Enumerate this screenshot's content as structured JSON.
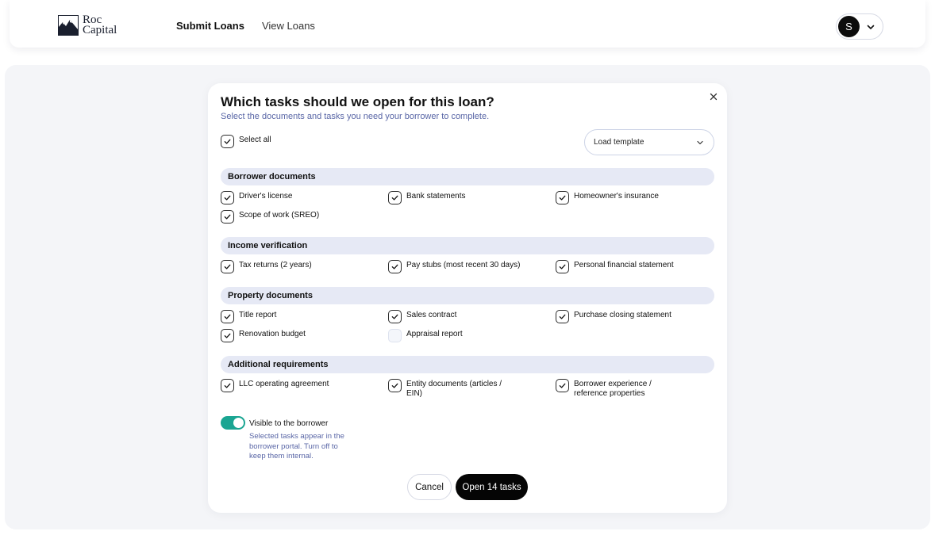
{
  "header": {
    "logo": {
      "line1": "Roc",
      "line2": "Capital"
    },
    "nav": [
      {
        "label": "Submit Loans",
        "active": true
      },
      {
        "label": "View Loans",
        "active": false
      }
    ],
    "user": {
      "initial": "S",
      "icon": "chevron-down-icon"
    }
  },
  "modal": {
    "title": "Which tasks should we open for this loan?",
    "subtitle": "Select the documents and tasks you need your borrower to complete.",
    "select_all": {
      "label": "Select all",
      "checked": true
    },
    "template_select": {
      "value": "Load template",
      "icon": "chevron-down-icon"
    },
    "close_icon": "close-icon",
    "sections": [
      {
        "title": "Borrower documents",
        "items": [
          {
            "label": "Driver's license",
            "checked": true
          },
          {
            "label": "Bank statements",
            "checked": true
          },
          {
            "label": "Homeowner's insurance",
            "checked": true
          },
          {
            "label": "Scope of work (SREO)",
            "checked": true
          }
        ]
      },
      {
        "title": "Income verification",
        "items": [
          {
            "label": "Tax returns (2 years)",
            "checked": true
          },
          {
            "label": "Pay stubs (most recent 30 days)",
            "checked": true
          },
          {
            "label": "Personal financial statement",
            "checked": true
          }
        ]
      },
      {
        "title": "Property documents",
        "items": [
          {
            "label": "Title report",
            "checked": true
          },
          {
            "label": "Sales contract",
            "checked": true
          },
          {
            "label": "Purchase closing statement",
            "checked": true
          },
          {
            "label": "Renovation budget",
            "checked": true
          },
          {
            "label": "Appraisal report",
            "checked": false
          }
        ]
      },
      {
        "title": "Additional requirements",
        "items": [
          {
            "label": "LLC operating agreement",
            "checked": true
          },
          {
            "label": "Entity documents (articles / EIN)",
            "checked": true
          },
          {
            "label": "Borrower experience / reference properties",
            "checked": true
          }
        ]
      }
    ],
    "visibility": {
      "label": "Visible to the borrower",
      "help": "Selected tasks appear in the borrower portal. Turn off to keep them internal.",
      "enabled": true
    },
    "cancel_label": "Cancel",
    "submit_label": "Open 14 tasks"
  },
  "colors": {
    "accent_teal": "#1aa592",
    "subtitle_blue": "#5966a6",
    "section_bg": "#e6e9f5",
    "primary_button": "#050505"
  }
}
